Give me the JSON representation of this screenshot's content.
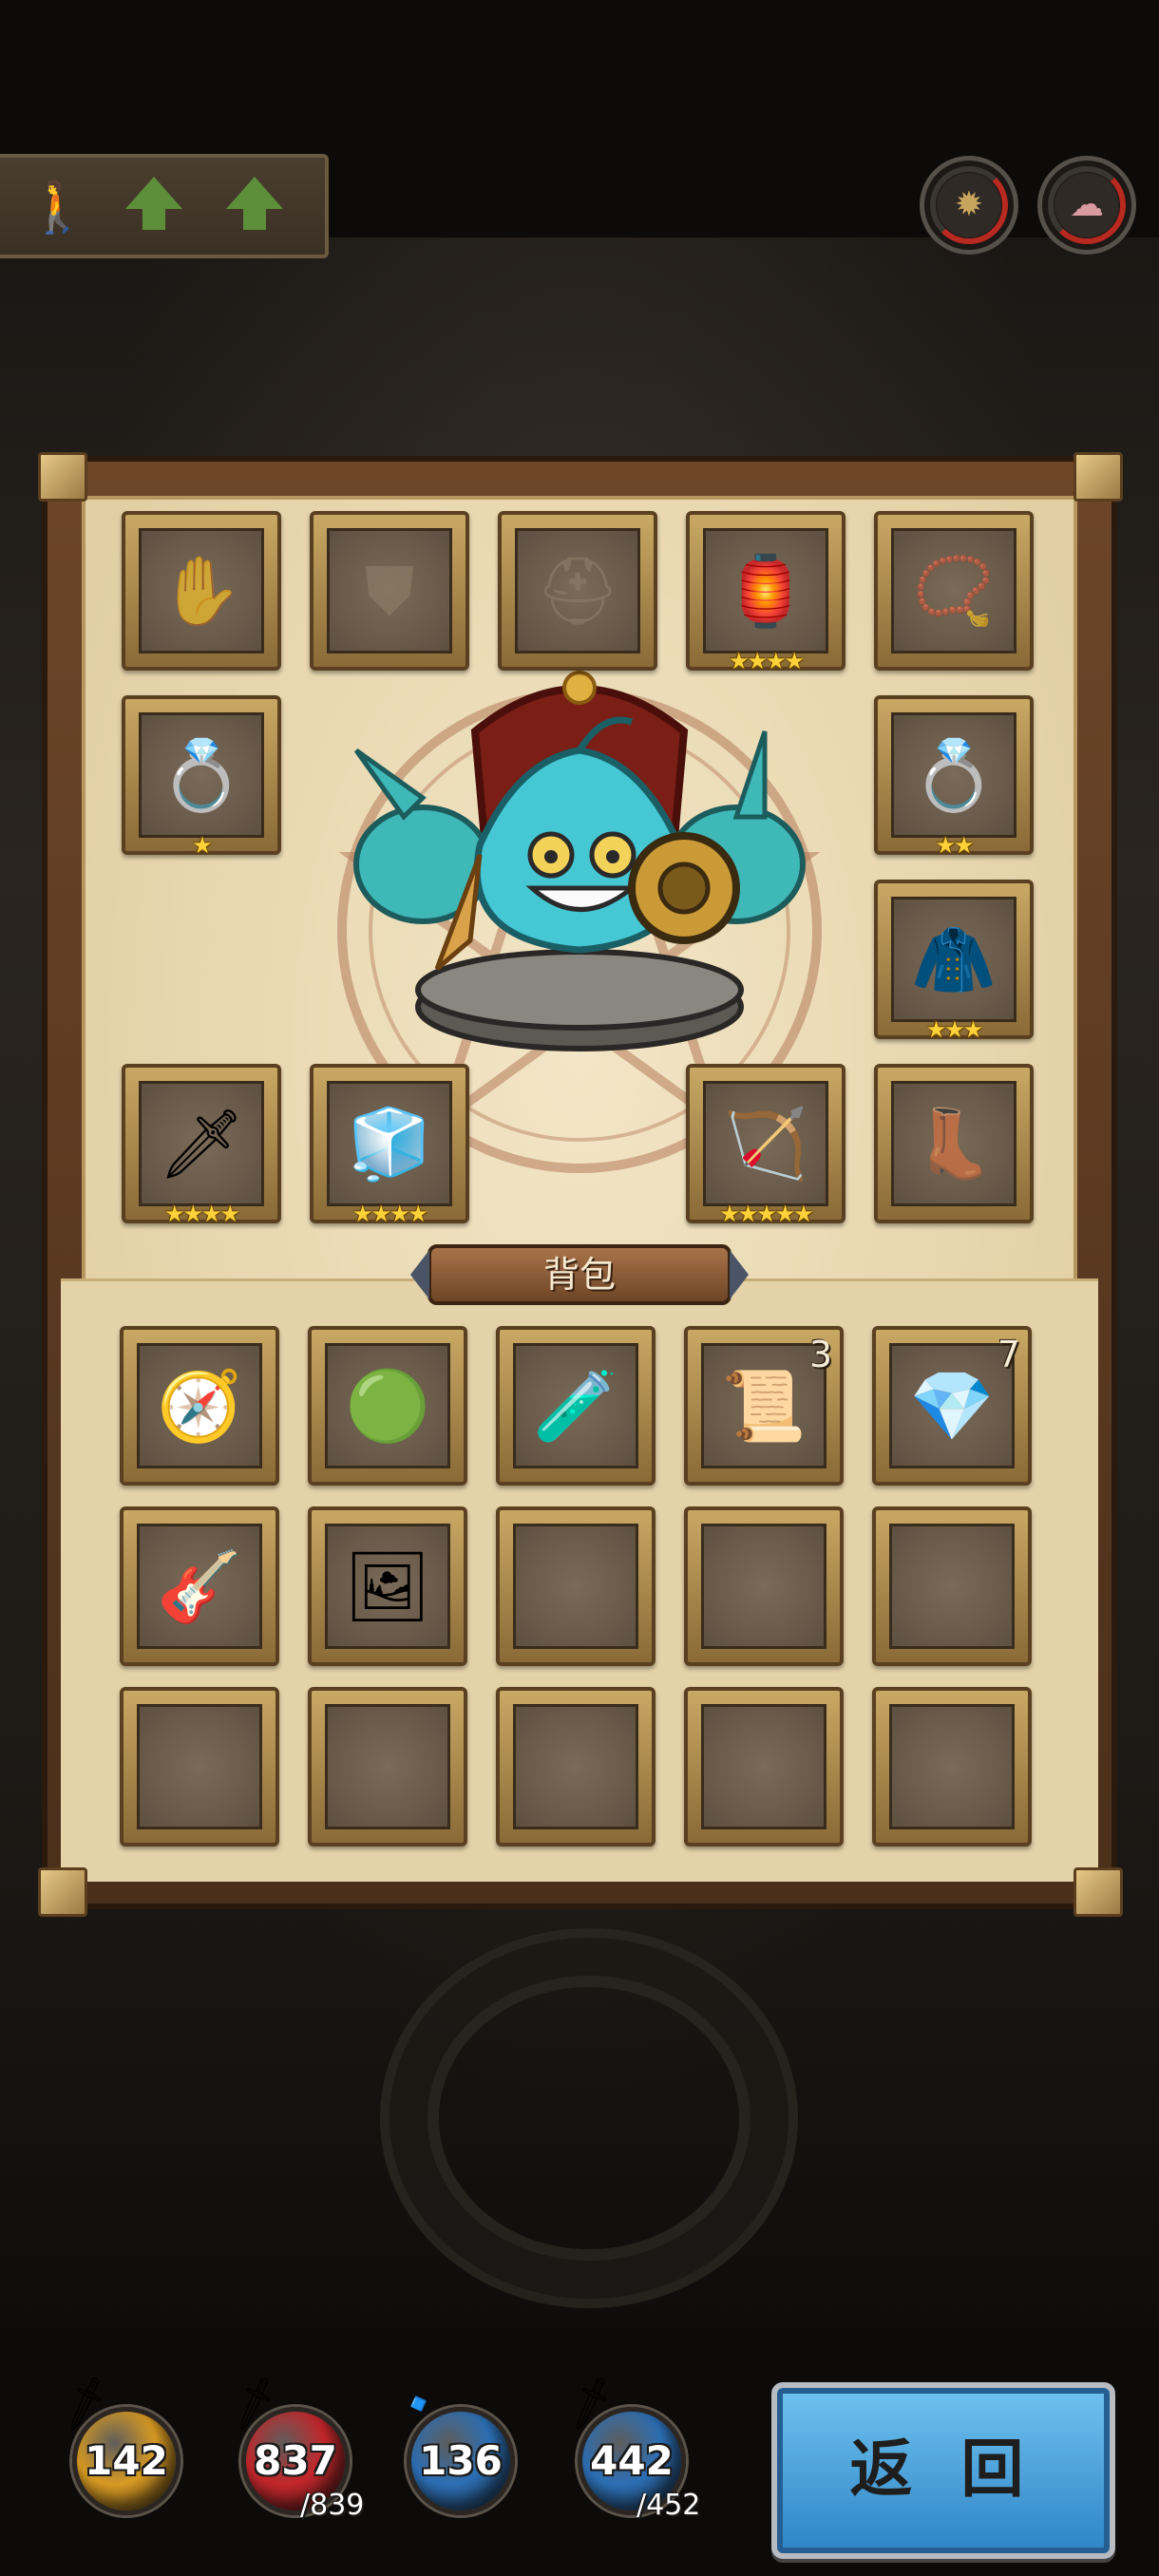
{
  "equipment": {
    "slots": [
      {
        "id": "gloves",
        "icon": "gloves-icon",
        "glyph": "✋",
        "empty": true,
        "stars": ""
      },
      {
        "id": "armor",
        "icon": "armor-icon",
        "glyph": "⛊",
        "empty": true,
        "stars": ""
      },
      {
        "id": "helmet",
        "icon": "helmet-icon",
        "glyph": "⛑",
        "empty": true,
        "stars": ""
      },
      {
        "id": "lantern",
        "icon": "lantern-icon",
        "glyph": "🏮",
        "empty": false,
        "stars": "★★★★"
      },
      {
        "id": "amulet",
        "icon": "amulet-icon",
        "glyph": "📿",
        "empty": true,
        "stars": ""
      },
      {
        "id": "ring-left",
        "icon": "ring-icon",
        "glyph": "💍",
        "empty": false,
        "stars": "★"
      },
      {
        "id": "ring-right",
        "icon": "ring-icon",
        "glyph": "💍",
        "empty": false,
        "stars": "★★"
      },
      {
        "id": "cape",
        "icon": "cape-icon",
        "glyph": "🧥",
        "empty": false,
        "stars": "★★★"
      },
      {
        "id": "dagger",
        "icon": "dagger-icon",
        "glyph": "🗡",
        "empty": false,
        "stars": "★★★★"
      },
      {
        "id": "ice-block",
        "icon": "ice-block-icon",
        "glyph": "🧊",
        "empty": false,
        "stars": "★★★★"
      },
      {
        "id": "harp-bow",
        "icon": "harp-bow-icon",
        "glyph": "🏹",
        "empty": false,
        "stars": "★★★★★"
      },
      {
        "id": "boots",
        "icon": "boots-icon",
        "glyph": "👢",
        "empty": true,
        "stars": ""
      }
    ]
  },
  "bag": {
    "title": "背包",
    "items": [
      {
        "icon": "compass-icon",
        "glyph": "🧭",
        "count": ""
      },
      {
        "icon": "slime-doll-icon",
        "glyph": "🟢",
        "count": ""
      },
      {
        "icon": "potion-icon",
        "glyph": "🧪",
        "count": ""
      },
      {
        "icon": "scroll-icon",
        "glyph": "📜",
        "count": "3"
      },
      {
        "icon": "crystal-icon",
        "glyph": "💎",
        "count": "7"
      },
      {
        "icon": "guitar-icon",
        "glyph": "🎸",
        "count": ""
      },
      {
        "icon": "photo-icon",
        "glyph": "🖼",
        "count": ""
      },
      {
        "icon": "",
        "glyph": "",
        "count": ""
      },
      {
        "icon": "",
        "glyph": "",
        "count": ""
      },
      {
        "icon": "",
        "glyph": "",
        "count": ""
      },
      {
        "icon": "",
        "glyph": "",
        "count": ""
      },
      {
        "icon": "",
        "glyph": "",
        "count": ""
      },
      {
        "icon": "",
        "glyph": "",
        "count": ""
      },
      {
        "icon": "",
        "glyph": "",
        "count": ""
      },
      {
        "icon": "",
        "glyph": "",
        "count": ""
      }
    ]
  },
  "stats": {
    "attack": {
      "value": "142",
      "color": "#d89a22"
    },
    "hp": {
      "value": "837",
      "max": "/839",
      "color": "#c4262a"
    },
    "magic": {
      "value": "136",
      "color": "#2c6fb5"
    },
    "mp": {
      "value": "442",
      "max": "/452",
      "color": "#2c6fb5"
    }
  },
  "back_button": "返 回",
  "colors": {
    "panel": "#e2cfa4",
    "frame": "#6d4628",
    "button": "#3a96d8"
  }
}
